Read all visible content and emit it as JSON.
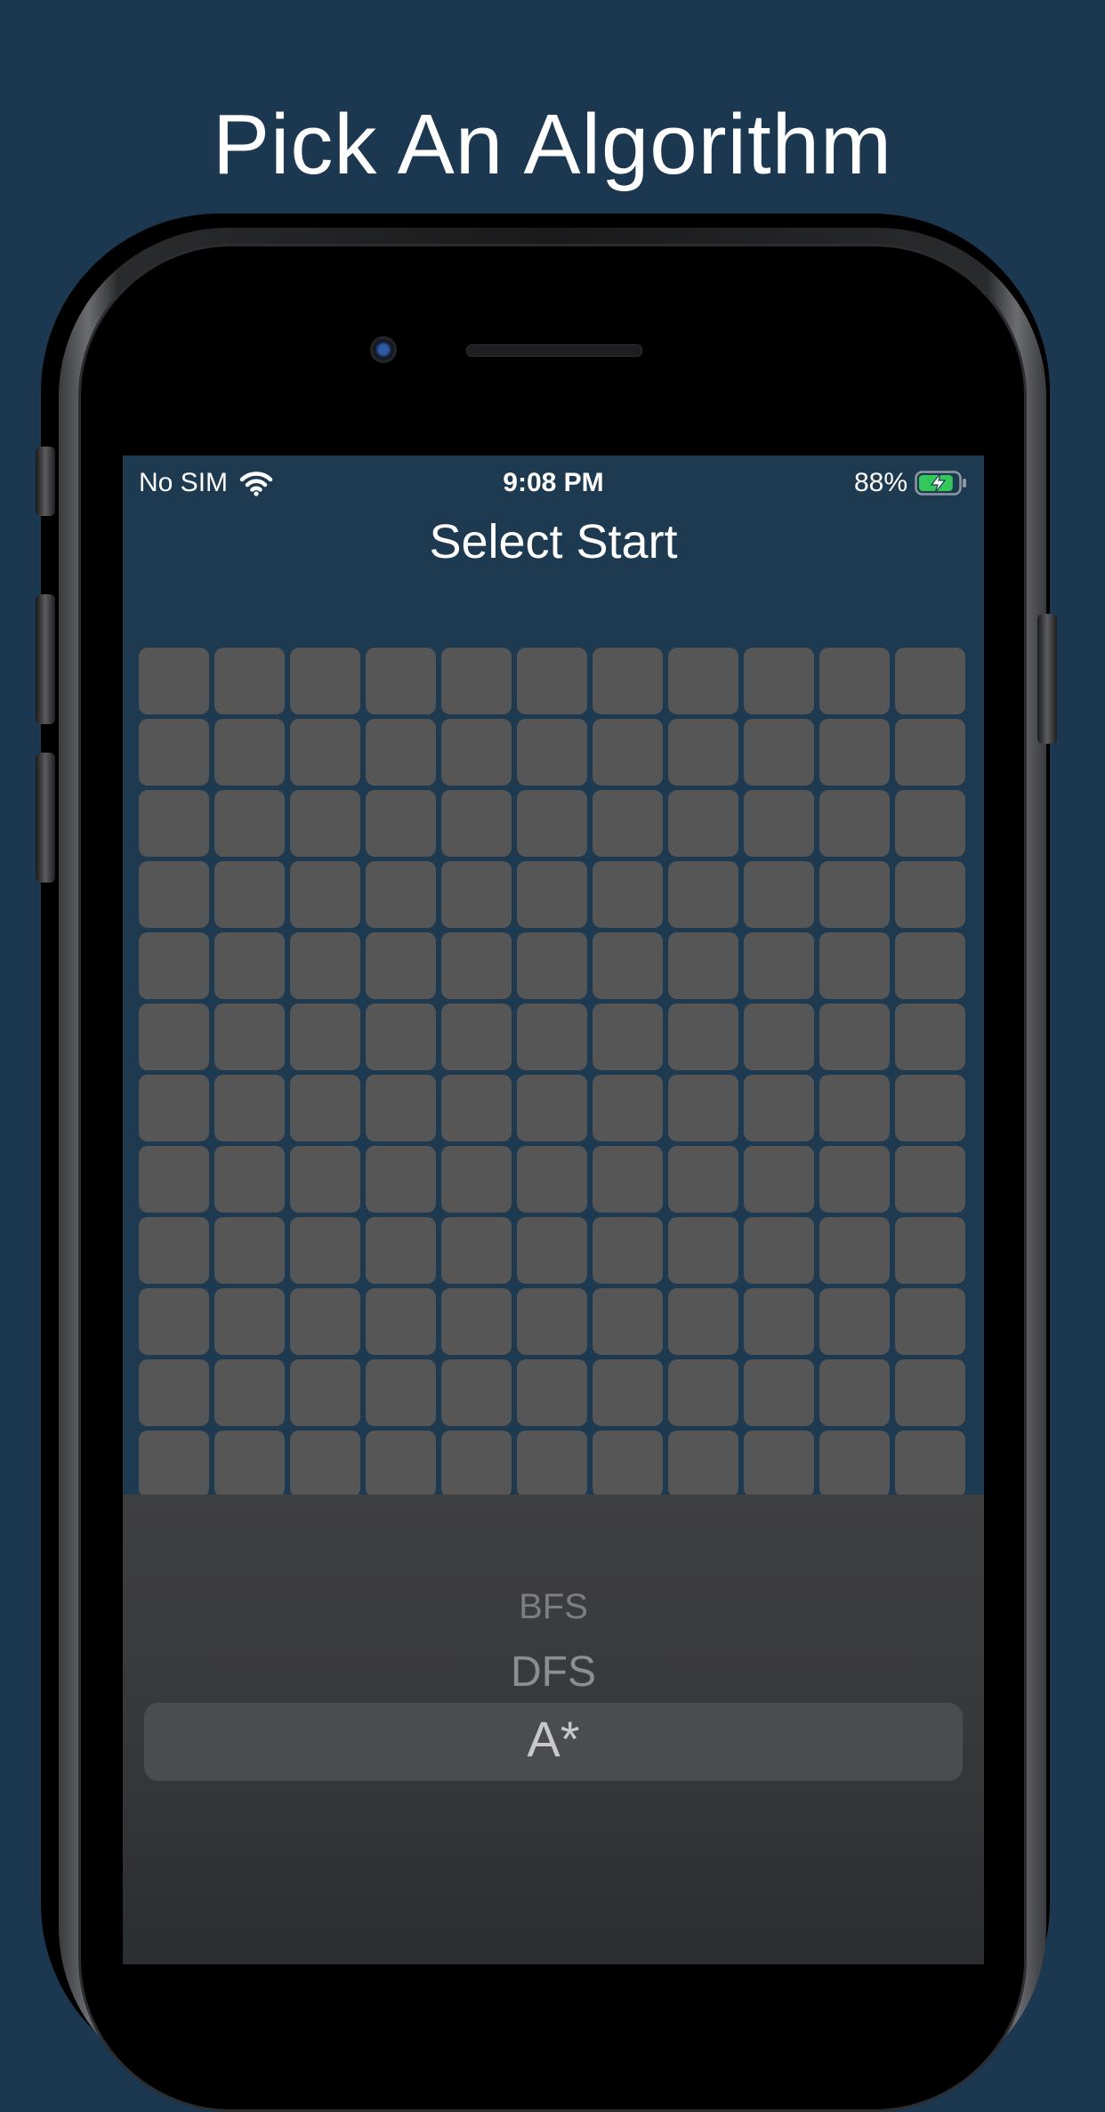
{
  "headline": "Pick An Algorithm",
  "status_bar": {
    "carrier": "No SIM",
    "wifi_icon": "wifi-icon",
    "time": "9:08 PM",
    "battery_percent": "88%",
    "battery_level": 0.88,
    "battery_icon": "battery-charging-icon",
    "battery_color": "#34c759"
  },
  "screen": {
    "title": "Select Start",
    "grid": {
      "rows": 12,
      "cols": 11,
      "cell_color": "#565656"
    }
  },
  "picker": {
    "options": [
      "BFS",
      "DFS",
      "A*"
    ],
    "selected": "A*"
  },
  "colors": {
    "background": "#1c3850",
    "screen_background": "#1e3a50",
    "picker_background": "#3a3b3d"
  }
}
